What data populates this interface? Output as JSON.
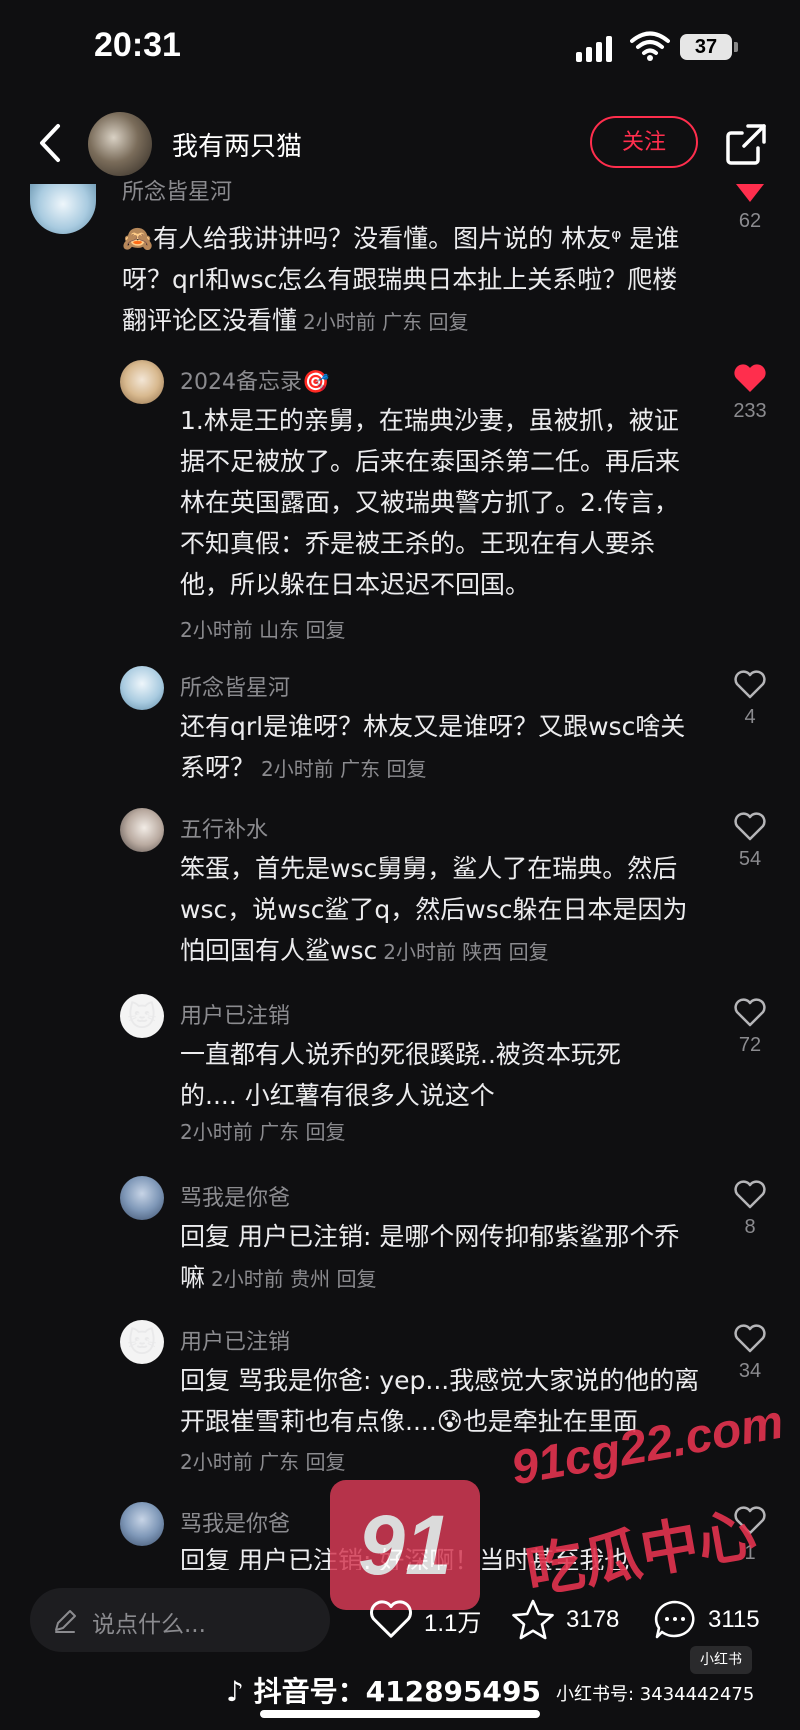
{
  "status": {
    "time": "20:31",
    "battery": "37"
  },
  "header": {
    "username": "我有两只猫",
    "follow_label": "关注"
  },
  "comments": [
    {
      "name": "所念皆星河",
      "text": "有人给我讲讲吗？没看懂。图片说的 林友ᵠ 是谁呀？qrl和wsc怎么有跟瑞典日本扯上关系啦？爬楼翻评论区没看懂",
      "meta": "2小时前 广东 回复",
      "likes": "62"
    },
    {
      "name": "2024备忘录🎯",
      "text": "1.林是王的亲舅，在瑞典沙妻，虽被抓，被证据不足被放了。后来在泰国杀第二任。再后来林在英国露面，又被瑞典警方抓了。2.传言，不知真假：乔是被王杀的。王现在有人要杀他，所以躲在日本迟迟不回国。",
      "meta": "2小时前 山东 回复",
      "likes": "233"
    },
    {
      "name": "所念皆星河",
      "text": "还有qrl是谁呀？林友又是谁呀？又跟wsc啥关系呀？",
      "meta": "2小时前 广东 回复",
      "likes": "4"
    },
    {
      "name": "五行补水",
      "text": "笨蛋，首先是wsc舅舅，鲨人了在瑞典。然后wsc，说wsc鲨了q，然后wsc躲在日本是因为怕回国有人鲨wsc",
      "meta": "2小时前 陕西 回复",
      "likes": "54"
    },
    {
      "name": "用户已注销",
      "text": "一直都有人说乔的死很蹊跷..被资本玩死的.... 小红薯有很多人说这个",
      "meta": "2小时前 广东 回复",
      "likes": "72"
    },
    {
      "name": "骂我是你爸",
      "reply_prefix": "回复 用户已注销:",
      "text": "是哪个网传抑郁紫鲨那个乔嘛",
      "meta": "2小时前 贵州 回复",
      "likes": "8"
    },
    {
      "name": "用户已注销",
      "reply_prefix": "回复 骂我是你爸:",
      "text": "yep...我感觉大家说的他的离开跟崔雪莉也有点像....😰也是牵扯在里面",
      "meta": "2小时前 广东 回复",
      "likes": "34"
    },
    {
      "name": "骂我是你爸",
      "reply_prefix": "回复 用户已注销:",
      "text": "好深啊！当时甚至我也",
      "likes": "1"
    }
  ],
  "bottom": {
    "placeholder": "说点什么...",
    "likes": "1.1万",
    "stars": "3178",
    "comments": "3115"
  },
  "watermark": {
    "num": "91",
    "url": "91cg22.com",
    "cn": "吃瓜中心"
  },
  "footer": {
    "douyin": "抖音号：412895495",
    "xhs_logo": "小红书",
    "xhs": "小红书号: 3434442475"
  },
  "colors": {
    "accent": "#ff2e4d",
    "background": "#0f0f11"
  }
}
